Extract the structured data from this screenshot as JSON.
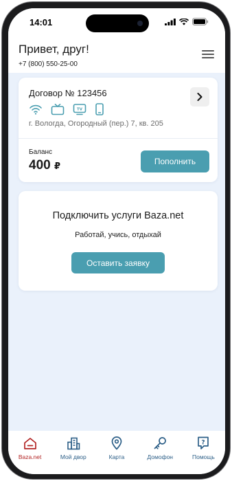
{
  "status_bar": {
    "time": "14:01"
  },
  "header": {
    "greeting": "Привет, друг!",
    "phone": "+7 (800) 550-25-00",
    "menu_icon": "hamburger-menu-icon"
  },
  "contract": {
    "title": "Договор № 123456",
    "services": [
      "wifi-icon",
      "tv-icon",
      "iptv-icon",
      "mobile-icon"
    ],
    "address": "г. Вологда, Огородный (пер.) 7, кв. 205",
    "balance_label": "Баланс",
    "balance_value": "400",
    "currency": "₽",
    "topup_label": "Пополнить"
  },
  "connect": {
    "title": "Подключить услуги Baza.net",
    "subtitle": "Работай, учись, отдыхай",
    "button_label": "Оставить заявку"
  },
  "bottom_nav": {
    "items": [
      {
        "label": "Baza.net",
        "icon": "home-icon",
        "active": true
      },
      {
        "label": "Мой двор",
        "icon": "buildings-icon",
        "active": false
      },
      {
        "label": "Карта",
        "icon": "map-pin-icon",
        "active": false
      },
      {
        "label": "Домофон",
        "icon": "key-icon",
        "active": false
      },
      {
        "label": "Помощь",
        "icon": "help-icon",
        "active": false
      }
    ]
  },
  "colors": {
    "accent": "#4a9eb0",
    "background": "#eaf1fb",
    "nav_active": "#b22222",
    "nav_inactive": "#2a5d86"
  }
}
